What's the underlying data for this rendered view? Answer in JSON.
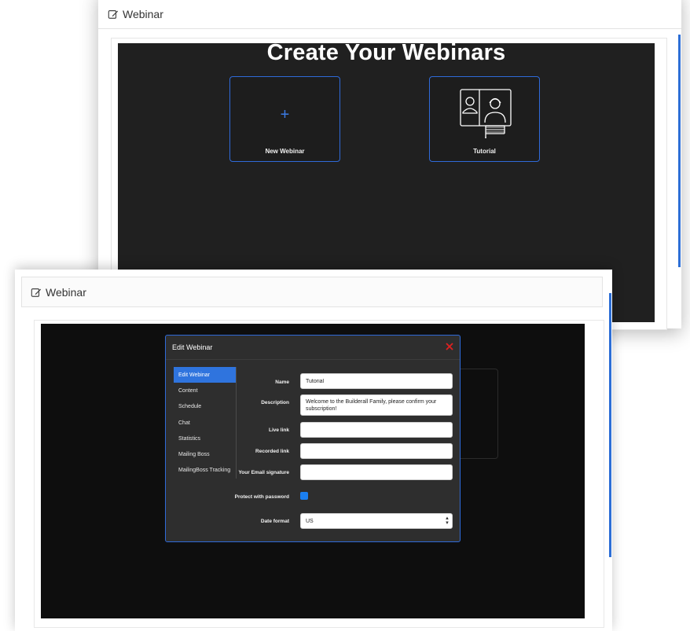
{
  "back": {
    "header_title": "Webinar",
    "heading": "Create Your Webinars",
    "cards": [
      {
        "label": "New Webinar",
        "icon": "plus-icon"
      },
      {
        "label": "Tutorial",
        "icon": "webinar-presentation-icon"
      }
    ]
  },
  "front": {
    "header_title": "Webinar",
    "modal": {
      "title": "Edit Webinar",
      "menu": [
        "Edit Webinar",
        "Content",
        "Schedule",
        "Chat",
        "Statistics",
        "Mailing Boss",
        "MailingBoss Tracking"
      ],
      "active_menu": "Edit Webinar",
      "fields": {
        "name_label": "Name",
        "name_value": "Tutorial",
        "description_label": "Description",
        "description_value": "Welcome to the Builderall Family, please confirm your subscription!",
        "live_link_label": "Live link",
        "live_link_value": "",
        "recorded_link_label": "Recorded link",
        "recorded_link_value": "",
        "email_signature_label": "Your Email signature",
        "email_signature_value": "",
        "protect_label": "Protect with password",
        "protect_checked": true,
        "date_format_label": "Date format",
        "date_format_value": "US"
      }
    }
  },
  "colors": {
    "accent": "#2f6ad9",
    "close": "#e02020",
    "canvas_dark": "#202020",
    "modal_bg": "#2e2e2e"
  }
}
